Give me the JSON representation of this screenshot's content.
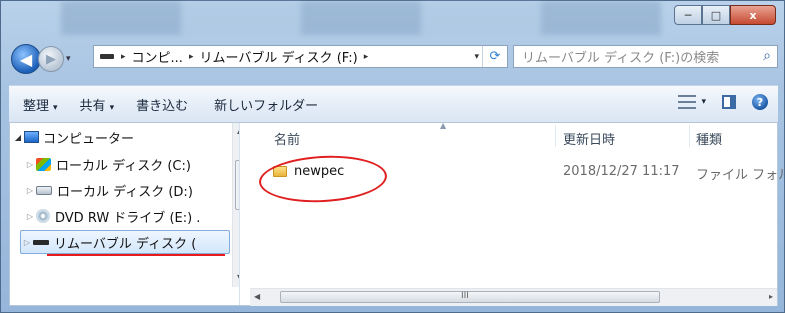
{
  "window": {
    "min_label": "─",
    "max_label": "□",
    "close_label": "x"
  },
  "nav": {
    "back_label": "◀",
    "forward_label": "▶",
    "history_dropdown": "▾"
  },
  "address": {
    "crumbs": [
      "コンピ...",
      "リムーバブル ディスク (F:)"
    ],
    "separator": "▸",
    "dropdown": "▾",
    "refresh": "⟳"
  },
  "search": {
    "placeholder": "リムーバブル ディスク (F:)の検索",
    "icon": "⌕"
  },
  "toolbar": {
    "organize": "整理",
    "share": "共有",
    "burn": "書き込む",
    "new_folder": "新しいフォルダー",
    "dropdown": "▾",
    "help": "?"
  },
  "tree": {
    "items": [
      {
        "label": "コンピューター",
        "icon": "computer-icon"
      },
      {
        "label": "ローカル ディスク (C:)",
        "icon": "windows-drive-icon"
      },
      {
        "label": "ローカル ディスク (D:)",
        "icon": "hard-drive-icon"
      },
      {
        "label": "DVD RW ドライブ (E:) .",
        "icon": "dvd-drive-icon"
      },
      {
        "label": "リムーバブル ディスク (",
        "icon": "removable-disk-icon"
      }
    ],
    "expanded_glyph": "◢",
    "collapsed_glyph": "▷"
  },
  "columns": {
    "name": "名前",
    "date": "更新日時",
    "type": "種類",
    "sort_glyph": "▲"
  },
  "files": [
    {
      "name": "newpec",
      "date": "2018/12/27 11:17",
      "type": "ファイル フォル",
      "icon": "folder-icon"
    }
  ],
  "scrollbar": {
    "up": "▲",
    "down": "▼",
    "left": "◀",
    "right": "▸",
    "grip": "III"
  },
  "annotations": {
    "circle_color": "#e02020",
    "underline_color": "#e81a1a"
  }
}
